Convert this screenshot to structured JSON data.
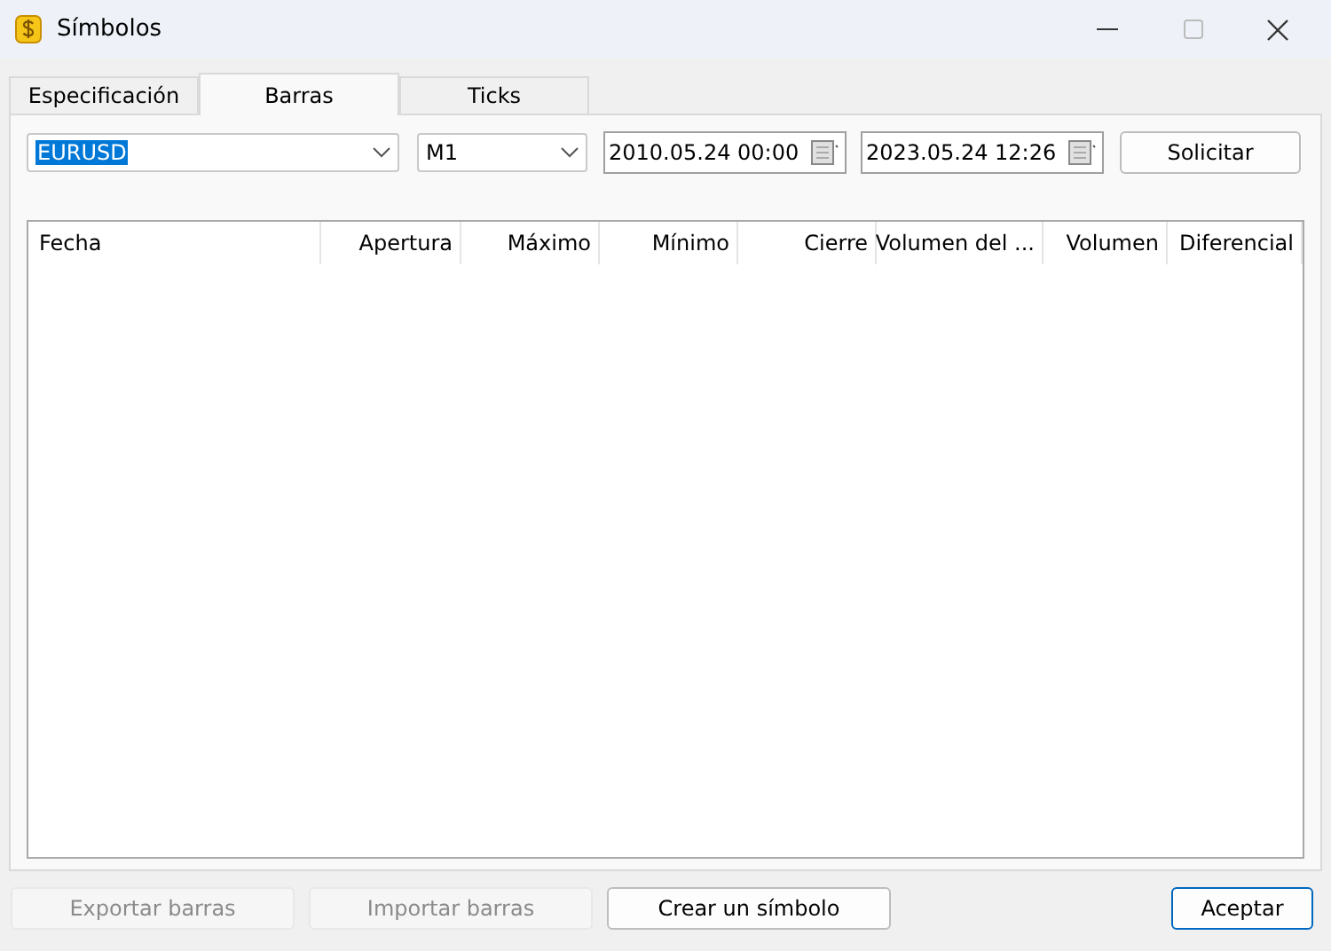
{
  "window": {
    "title": "Símbolos"
  },
  "tabs": [
    {
      "label": "Especificación",
      "selected": false
    },
    {
      "label": "Barras",
      "selected": true
    },
    {
      "label": "Ticks",
      "selected": false
    }
  ],
  "filters": {
    "symbol": {
      "value": "EURUSD",
      "highlighted": true
    },
    "timeframe": {
      "value": "M1"
    },
    "date_from": {
      "value": "2010.05.24 00:00"
    },
    "date_to": {
      "value": "2023.05.24 12:26"
    },
    "request_button": "Solicitar"
  },
  "table": {
    "columns": [
      "Fecha",
      "Apertura",
      "Máximo",
      "Mínimo",
      "Cierre",
      "Volumen del ...",
      "Volumen",
      "Diferencial"
    ]
  },
  "buttons": [
    {
      "label": "Exportar barras",
      "disabled": true,
      "default": false
    },
    {
      "label": "Importar barras",
      "disabled": true,
      "default": false
    },
    {
      "label": "Crear un símbolo",
      "disabled": false,
      "default": false
    },
    {
      "label": "Aceptar",
      "disabled": false,
      "default": true
    }
  ]
}
